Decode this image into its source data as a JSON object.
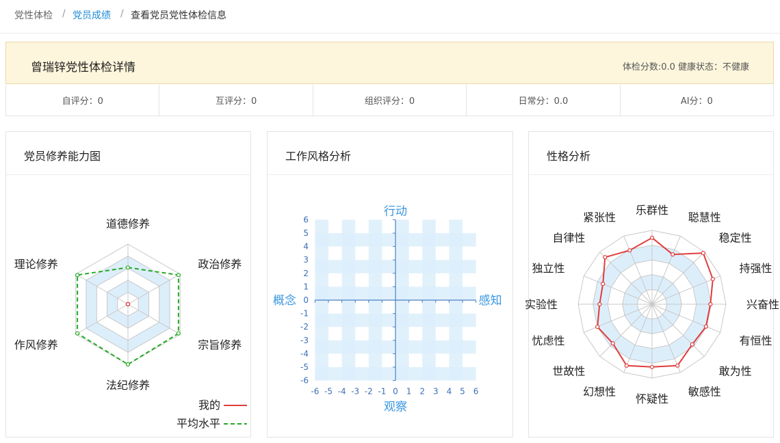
{
  "breadcrumb": {
    "items": [
      "党性体检",
      "党员成绩",
      "查看党员党性体检信息"
    ],
    "separator": "/"
  },
  "detail": {
    "title": "曾瑞锌党性体检详情",
    "status": "体检分数:0.0 健康状态：不健康"
  },
  "scores": [
    "自评分：0",
    "互评分：0",
    "组织评分：0",
    "日常分：0.0",
    "AI分：0"
  ],
  "panels": {
    "ability": {
      "title": "党员修养能力图",
      "chart_data": {
        "type": "radar",
        "categories": [
          "道德修养",
          "政治修养",
          "宗旨修养",
          "法纪修养",
          "作风修养",
          "理论修养"
        ],
        "series": [
          {
            "name": "我的",
            "values": [
              0,
              0,
              0,
              0,
              0,
              0
            ],
            "color": "#e03c3c",
            "style": "solid"
          },
          {
            "name": "平均水平",
            "values": [
              0.61,
              0.97,
              0.97,
              1.0,
              0.97,
              0.97
            ],
            "color": "#22aa22",
            "style": "dashed"
          }
        ],
        "rings": 5,
        "legend": "bottom-right"
      }
    },
    "workstyle": {
      "title": "工作风格分析",
      "chart_data": {
        "type": "quadrant",
        "xlim": [
          -6,
          6
        ],
        "ylim": [
          -6,
          6
        ],
        "x_ticks": [
          "-6",
          "-5",
          "-4",
          "-3",
          "-2",
          "-1",
          "0",
          "1",
          "2",
          "3",
          "4",
          "5",
          "6"
        ],
        "y_ticks": [
          "6",
          "5",
          "4",
          "3",
          "2",
          "1",
          "0",
          "-1",
          "-2",
          "-3",
          "-4",
          "-5",
          "-6"
        ],
        "top_label": "行动",
        "bottom_label": "观察",
        "left_label": "概念",
        "right_label": "感知",
        "points": []
      }
    },
    "personality": {
      "title": "性格分析",
      "chart_data": {
        "type": "radar",
        "categories": [
          "乐群性",
          "聪慧性",
          "稳定性",
          "持强性",
          "兴奋性",
          "有恒性",
          "敢为性",
          "敏感性",
          "怀疑性",
          "幻想性",
          "世故性",
          "忧虑性",
          "实验性",
          "独立性",
          "自律性",
          "紧张性"
        ],
        "series": [
          {
            "name": "我的",
            "values": [
              0.9,
              0.73,
              0.98,
              0.89,
              0.79,
              0.79,
              0.77,
              0.9,
              0.85,
              0.9,
              0.75,
              0.8,
              0.71,
              0.72,
              0.9,
              0.79
            ],
            "color": "#e03c3c",
            "style": "solid"
          }
        ],
        "rings": 5
      }
    }
  },
  "colors": {
    "link": "#1f8ad6",
    "axis_label": "#3b97e0",
    "band": "#dceefb",
    "my_series": "#e03c3c",
    "avg_series": "#22aa22"
  }
}
